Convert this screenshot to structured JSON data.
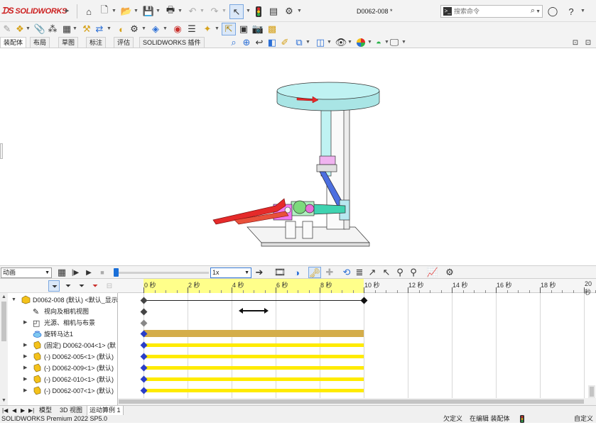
{
  "app": {
    "logo_text": "SOLIDWORKS",
    "document_title": "D0062-008 *"
  },
  "search": {
    "placeholder": "搜索命令"
  },
  "command_tabs": [
    "装配体",
    "布局",
    "草图",
    "标注",
    "评估",
    "SOLIDWORKS 插件"
  ],
  "motion": {
    "study_type": "动画",
    "playback_speed": "1x"
  },
  "timeline": {
    "ticks": [
      "0 秒",
      "2 秒",
      "4 秒",
      "6 秒",
      "8 秒",
      "10 秒",
      "12 秒",
      "14 秒",
      "16 秒",
      "18 秒",
      "20 秒"
    ]
  },
  "tree": {
    "root": "D0062-008 (默认) <默认_显示",
    "items": [
      {
        "label": "视向及相机视图",
        "icon": "camera-view-icon"
      },
      {
        "label": "光源、相机与布景",
        "icon": "lights-icon"
      },
      {
        "label": "旋转马达1",
        "icon": "rotary-motor-icon"
      },
      {
        "label": "(固定) D0062-004<1> (默",
        "icon": "part-icon"
      },
      {
        "label": "(-) D0062-005<1> (默认)",
        "icon": "part-icon"
      },
      {
        "label": "(-) D0062-009<1> (默认)",
        "icon": "part-icon"
      },
      {
        "label": "(-) D0062-010<1> (默认)",
        "icon": "part-icon"
      },
      {
        "label": "(-) D0062-007<1> (默认)",
        "icon": "part-icon"
      }
    ]
  },
  "bottom_tabs": [
    "模型",
    "3D 视图",
    "运动算例 1"
  ],
  "status": {
    "product": "SOLIDWORKS Premium 2022 SP5.0",
    "underdefined": "欠定义",
    "editing": "在编辑 装配体",
    "custom": "自定义"
  },
  "colors": {
    "accent_blue": "#1a6fd8",
    "timeline_yellow": "#ffff8a",
    "bar_yellow": "#ffeb00",
    "motor_bar": "#d4ad4a",
    "logo_red": "#cc1f1f"
  }
}
